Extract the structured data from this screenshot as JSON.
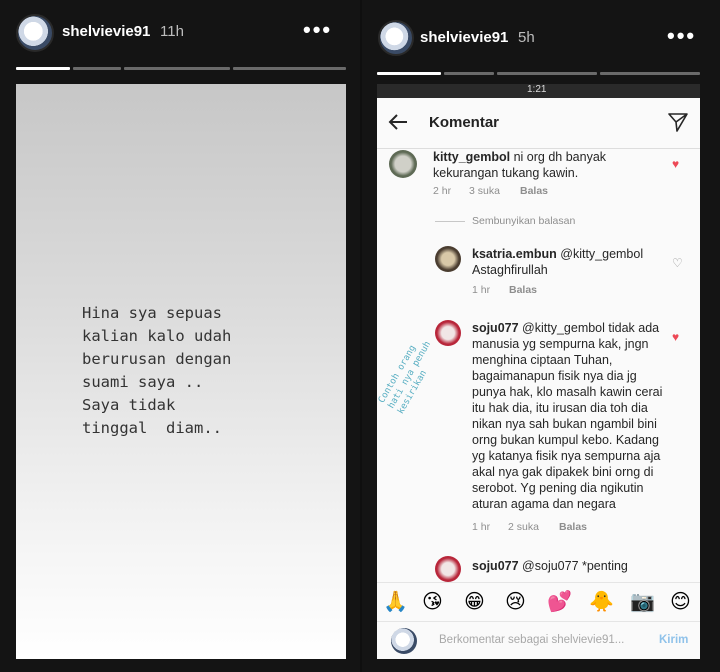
{
  "left_story": {
    "username": "shelvievie91",
    "time": "11h",
    "menu": "•••",
    "text": "Hina sya sepuas\nkalian kalo udah\nberurusan dengan\nsuami saya ..\nSaya tidak\ntinggal  diam.."
  },
  "right_story": {
    "username": "shelvievie91",
    "time": "5h",
    "menu": "•••",
    "overlay_text": "Contoh orang\nhati nya penuh\nkesirikan"
  },
  "phone": {
    "status_time": "1:21",
    "header_title": "Komentar",
    "comments": [
      {
        "user": "kitty_gembol",
        "text": "ni org dh banyak kekurangan tukang kawin.",
        "time": "2 hr",
        "likes": "3 suka",
        "reply": "Balas",
        "liked": true
      },
      {
        "hide_replies": "Sembunyikan balasan"
      },
      {
        "user": "ksatria.embun",
        "text": "@kitty_gembol Astaghfirullah",
        "time": "1 hr",
        "reply": "Balas",
        "liked": false
      },
      {
        "user": "soju077",
        "text": "@kitty_gembol tidak ada manusia yg sempurna kak, jngn menghina ciptaan Tuhan, bagaimanapun fisik nya dia jg punya hak, klo masalh kawin cerai itu hak dia, itu irusan dia toh dia nikan nya sah bukan ngambil bini orng bukan kumpul kebo. Kadang yg katanya fisik nya sempurna aja akal nya gak dipakek bini orng di serobot. Yg pening dia ngikutin aturan agama dan negara",
        "time": "1 hr",
        "likes": "2 suka",
        "reply": "Balas",
        "liked": true
      },
      {
        "user": "soju077",
        "text": "@soju077 *penting"
      }
    ],
    "emojis": [
      "🙏",
      "😘",
      "😁",
      "😢",
      "💕",
      "🐥",
      "📷",
      "😊"
    ],
    "input_placeholder": "Berkomentar sebagai shelvievie91...",
    "post_label": "Kirim",
    "colors": {
      "heart": "#ed4956",
      "meta": "#8e8e8e",
      "post": "#8fc2ea"
    }
  }
}
